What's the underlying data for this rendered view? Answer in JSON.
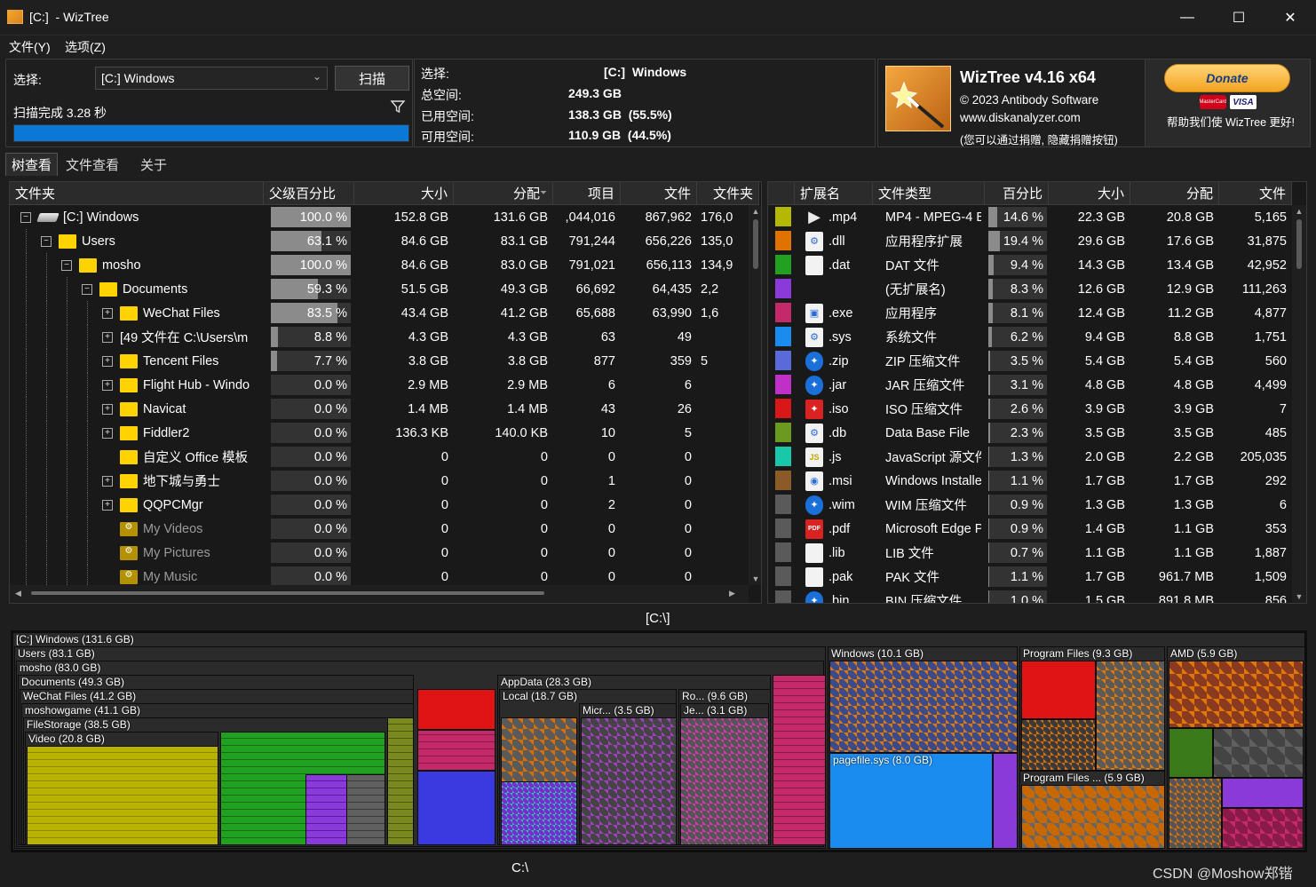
{
  "window": {
    "title": "[C:]  - WizTree",
    "minimize_glyph": "—",
    "maximize_glyph": "☐",
    "close_glyph": "✕"
  },
  "menu": [
    "文件(Y)",
    "选项(Z)"
  ],
  "scan": {
    "select_label": "选择:",
    "drive_value": "[C:] Windows",
    "scan_button": "扫描",
    "status": "扫描完成 3.28 秒",
    "progress": 1.0
  },
  "summary": {
    "select_label": "选择:",
    "select_value": "[C:]  Windows",
    "total_label": "总空间:",
    "total_value": "249.3 GB",
    "used_label": "已用空间:",
    "used_value": "138.3 GB  (55.5%)",
    "free_label": "可用空间:",
    "free_value": "110.9 GB  (44.5%)"
  },
  "about": {
    "product": "WizTree v4.16 x64",
    "copyright": "© 2023 Antibody Software",
    "website": "www.diskanalyzer.com",
    "note": "(您可以通过捐赠, 隐藏捐赠按钮)",
    "donate_label": "Donate",
    "donate_help": "帮助我们使 WizTree 更好!",
    "card_mastercard": "MasterCard",
    "card_visa": "VISA"
  },
  "tabs": [
    "树查看",
    "文件查看",
    "关于"
  ],
  "tree": {
    "columns": [
      "文件夹",
      "父级百分比",
      "大小",
      "分配",
      "项目",
      "文件",
      "文件夹"
    ],
    "rows": [
      {
        "name": "[C:] Windows",
        "pct": "100.0 %",
        "pct_value": 100.0,
        "size": "152.8 GB",
        "alloc": "131.6 GB",
        "items": ",044,016",
        "files": "867,962",
        "folders": "176,0",
        "level": 0,
        "expander": "−",
        "icon": "drive"
      },
      {
        "name": "Users",
        "pct": "63.1 %",
        "pct_value": 63.1,
        "size": "84.6 GB",
        "alloc": "83.1 GB",
        "items": "791,244",
        "files": "656,226",
        "folders": "135,0",
        "level": 1,
        "expander": "−",
        "icon": "folder"
      },
      {
        "name": "mosho",
        "pct": "100.0 %",
        "pct_value": 100.0,
        "size": "84.6 GB",
        "alloc": "83.0 GB",
        "items": "791,021",
        "files": "656,113",
        "folders": "134,9",
        "level": 2,
        "expander": "−",
        "icon": "folder"
      },
      {
        "name": "Documents",
        "pct": "59.3 %",
        "pct_value": 59.3,
        "size": "51.5 GB",
        "alloc": "49.3 GB",
        "items": "66,692",
        "files": "64,435",
        "folders": "2,2",
        "level": 3,
        "expander": "−",
        "icon": "folder"
      },
      {
        "name": "WeChat Files",
        "pct": "83.5 %",
        "pct_value": 83.5,
        "size": "43.4 GB",
        "alloc": "41.2 GB",
        "items": "65,688",
        "files": "63,990",
        "folders": "1,6",
        "level": 4,
        "expander": "+",
        "icon": "folder"
      },
      {
        "name": "[49 文件在 C:\\Users\\m",
        "pct": "8.8 %",
        "pct_value": 8.8,
        "size": "4.3 GB",
        "alloc": "4.3 GB",
        "items": "63",
        "files": "49",
        "folders": "",
        "level": 4,
        "expander": "+",
        "icon": "none"
      },
      {
        "name": "Tencent Files",
        "pct": "7.7 %",
        "pct_value": 7.7,
        "size": "3.8 GB",
        "alloc": "3.8 GB",
        "items": "877",
        "files": "359",
        "folders": "5",
        "level": 4,
        "expander": "+",
        "icon": "folder"
      },
      {
        "name": "Flight Hub - Windo",
        "pct": "0.0 %",
        "pct_value": 0.0,
        "size": "2.9 MB",
        "alloc": "2.9 MB",
        "items": "6",
        "files": "6",
        "folders": "",
        "level": 4,
        "expander": "+",
        "icon": "folder"
      },
      {
        "name": "Navicat",
        "pct": "0.0 %",
        "pct_value": 0.0,
        "size": "1.4 MB",
        "alloc": "1.4 MB",
        "items": "43",
        "files": "26",
        "folders": "",
        "level": 4,
        "expander": "+",
        "icon": "folder"
      },
      {
        "name": "Fiddler2",
        "pct": "0.0 %",
        "pct_value": 0.0,
        "size": "136.3 KB",
        "alloc": "140.0 KB",
        "items": "10",
        "files": "5",
        "folders": "",
        "level": 4,
        "expander": "+",
        "icon": "folder"
      },
      {
        "name": "自定义 Office 模板",
        "pct": "0.0 %",
        "pct_value": 0.0,
        "size": "0",
        "alloc": "0",
        "items": "0",
        "files": "0",
        "folders": "",
        "level": 4,
        "expander": "",
        "icon": "folder"
      },
      {
        "name": "地下城与勇士",
        "pct": "0.0 %",
        "pct_value": 0.0,
        "size": "0",
        "alloc": "0",
        "items": "1",
        "files": "0",
        "folders": "",
        "level": 4,
        "expander": "+",
        "icon": "folder"
      },
      {
        "name": "QQPCMgr",
        "pct": "0.0 %",
        "pct_value": 0.0,
        "size": "0",
        "alloc": "0",
        "items": "2",
        "files": "0",
        "folders": "",
        "level": 4,
        "expander": "+",
        "icon": "folder"
      },
      {
        "name": "My Videos",
        "pct": "0.0 %",
        "pct_value": 0.0,
        "size": "0",
        "alloc": "0",
        "items": "0",
        "files": "0",
        "folders": "",
        "level": 4,
        "expander": "",
        "icon": "folder-grey"
      },
      {
        "name": "My Pictures",
        "pct": "0.0 %",
        "pct_value": 0.0,
        "size": "0",
        "alloc": "0",
        "items": "0",
        "files": "0",
        "folders": "",
        "level": 4,
        "expander": "",
        "icon": "folder-grey"
      },
      {
        "name": "My Music",
        "pct": "0.0 %",
        "pct_value": 0.0,
        "size": "0",
        "alloc": "0",
        "items": "0",
        "files": "0",
        "folders": "",
        "level": 4,
        "expander": "",
        "icon": "folder-grey"
      }
    ]
  },
  "ext": {
    "columns": [
      "扩展名",
      "文件类型",
      "百分比",
      "大小",
      "分配",
      "文件"
    ],
    "rows": [
      {
        "color": "#b5b800",
        "icon": "▶",
        "icon_style": "media",
        "ext": ".mp4",
        "type": "MP4 - MPEG-4 E",
        "pct": "14.6 %",
        "pct_value": 14.6,
        "size": "22.3 GB",
        "alloc": "20.8 GB",
        "files": "5,165"
      },
      {
        "color": "#e07200",
        "icon": "⚙",
        "icon_style": "file",
        "ext": ".dll",
        "type": "应用程序扩展",
        "pct": "19.4 %",
        "pct_value": 19.4,
        "size": "29.6 GB",
        "alloc": "17.6 GB",
        "files": "31,875"
      },
      {
        "color": "#22a020",
        "icon": "",
        "icon_style": "file",
        "ext": ".dat",
        "type": "DAT 文件",
        "pct": "9.4 %",
        "pct_value": 9.4,
        "size": "14.3 GB",
        "alloc": "13.4 GB",
        "files": "42,952"
      },
      {
        "color": "#8a3ad8",
        "icon": "",
        "icon_style": "none",
        "ext": "",
        "type": "(无扩展名)",
        "pct": "8.3 %",
        "pct_value": 8.3,
        "size": "12.6 GB",
        "alloc": "12.9 GB",
        "files": "111,263"
      },
      {
        "color": "#c42a6a",
        "icon": "▣",
        "icon_style": "file",
        "ext": ".exe",
        "type": "应用程序",
        "pct": "8.1 %",
        "pct_value": 8.1,
        "size": "12.4 GB",
        "alloc": "11.2 GB",
        "files": "4,877"
      },
      {
        "color": "#1a8cf0",
        "icon": "⚙",
        "icon_style": "file",
        "ext": ".sys",
        "type": "系统文件",
        "pct": "6.2 %",
        "pct_value": 6.2,
        "size": "9.4 GB",
        "alloc": "8.8 GB",
        "files": "1,751"
      },
      {
        "color": "#5a6ad8",
        "icon": "✦",
        "icon_style": "blue",
        "ext": ".zip",
        "type": "ZIP 压缩文件",
        "pct": "3.5 %",
        "pct_value": 3.5,
        "size": "5.4 GB",
        "alloc": "5.4 GB",
        "files": "560"
      },
      {
        "color": "#c030c8",
        "icon": "✦",
        "icon_style": "blue",
        "ext": ".jar",
        "type": "JAR 压缩文件",
        "pct": "3.1 %",
        "pct_value": 3.1,
        "size": "4.8 GB",
        "alloc": "4.8 GB",
        "files": "4,499"
      },
      {
        "color": "#d81818",
        "icon": "✦",
        "icon_style": "red",
        "ext": ".iso",
        "type": "ISO 压缩文件",
        "pct": "2.6 %",
        "pct_value": 2.6,
        "size": "3.9 GB",
        "alloc": "3.9 GB",
        "files": "7"
      },
      {
        "color": "#6a9a20",
        "icon": "⚙",
        "icon_style": "file",
        "ext": ".db",
        "type": "Data Base File",
        "pct": "2.3 %",
        "pct_value": 2.3,
        "size": "3.5 GB",
        "alloc": "3.5 GB",
        "files": "485"
      },
      {
        "color": "#18c8a8",
        "icon": "JS",
        "icon_style": "file",
        "ext": ".js",
        "type": "JavaScript 源文件",
        "pct": "1.3 %",
        "pct_value": 1.3,
        "size": "2.0 GB",
        "alloc": "2.2 GB",
        "files": "205,035"
      },
      {
        "color": "#8a5a28",
        "icon": "◉",
        "icon_style": "file",
        "ext": ".msi",
        "type": "Windows Installer",
        "pct": "1.1 %",
        "pct_value": 1.1,
        "size": "1.7 GB",
        "alloc": "1.7 GB",
        "files": "292"
      },
      {
        "color": "#5a5a5a",
        "icon": "✦",
        "icon_style": "blue",
        "ext": ".wim",
        "type": "WIM 压缩文件",
        "pct": "0.9 %",
        "pct_value": 0.9,
        "size": "1.3 GB",
        "alloc": "1.3 GB",
        "files": "6"
      },
      {
        "color": "#5a5a5a",
        "icon": "PDF",
        "icon_style": "red",
        "ext": ".pdf",
        "type": "Microsoft Edge PDF",
        "pct": "0.9 %",
        "pct_value": 0.9,
        "size": "1.4 GB",
        "alloc": "1.1 GB",
        "files": "353"
      },
      {
        "color": "#5a5a5a",
        "icon": "",
        "icon_style": "file",
        "ext": ".lib",
        "type": "LIB 文件",
        "pct": "0.7 %",
        "pct_value": 0.7,
        "size": "1.1 GB",
        "alloc": "1.1 GB",
        "files": "1,887"
      },
      {
        "color": "#5a5a5a",
        "icon": "",
        "icon_style": "file",
        "ext": ".pak",
        "type": "PAK 文件",
        "pct": "1.1 %",
        "pct_value": 1.1,
        "size": "1.7 GB",
        "alloc": "961.7 MB",
        "files": "1,509"
      },
      {
        "color": "#5a5a5a",
        "icon": "✦",
        "icon_style": "blue",
        "ext": ".bin",
        "type": "BIN 压缩文件",
        "pct": "1.0 %",
        "pct_value": 1.0,
        "size": "1.5 GB",
        "alloc": "891.8 MB",
        "files": "856"
      }
    ]
  },
  "path_top": "[C:\\]",
  "path_bottom": "C:\\",
  "treemap": {
    "labels": {
      "root": "[C:] Windows  (131.6 GB)",
      "users": "Users  (83.1 GB)",
      "mosho": "mosho  (83.0 GB)",
      "documents": "Documents  (49.3 GB)",
      "wechat": "WeChat Files  (41.2 GB)",
      "moshowgame": "moshowgame  (41.1 GB)",
      "filestorage": "FileStorage  (38.5 GB)",
      "video": "Video  (20.8 GB)",
      "appdata": "AppData  (28.3 GB)",
      "local": "Local  (18.7 GB)",
      "micr": "Micr... (3.5 GB)",
      "ro": "Ro... (9.6 GB)",
      "je": "Je... (3.1 GB)",
      "windows": "Windows  (10.1 GB)",
      "pagefile": "pagefile.sys (8.0 GB)",
      "programfiles": "Program Files  (9.3 GB)",
      "programfiles86": "Program Files ... (5.9 GB)",
      "amd": "AMD  (5.9 GB)"
    }
  },
  "watermark": "CSDN @Moshow郑锴"
}
